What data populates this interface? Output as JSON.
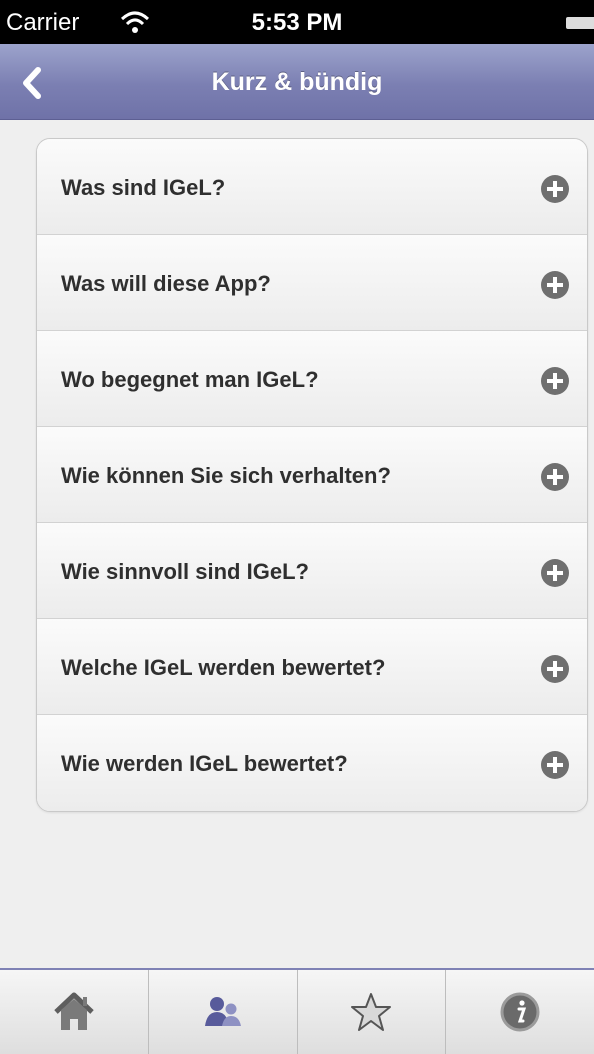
{
  "status_bar": {
    "carrier": "Carrier",
    "time": "5:53 PM"
  },
  "nav": {
    "title": "Kurz & bündig",
    "back_icon": "chevron-left-icon"
  },
  "list": {
    "items": [
      {
        "label": "Was sind IGeL?",
        "icon": "plus-circle-icon"
      },
      {
        "label": "Was will diese App?",
        "icon": "plus-circle-icon"
      },
      {
        "label": "Wo begegnet man IGeL?",
        "icon": "plus-circle-icon"
      },
      {
        "label": "Wie können Sie sich verhalten?",
        "icon": "plus-circle-icon"
      },
      {
        "label": "Wie sinnvoll sind IGeL?",
        "icon": "plus-circle-icon"
      },
      {
        "label": "Welche IGeL werden bewertet?",
        "icon": "plus-circle-icon"
      },
      {
        "label": "Wie werden IGeL bewertet?",
        "icon": "plus-circle-icon"
      }
    ]
  },
  "tab_bar": {
    "tabs": [
      {
        "icon": "home-icon"
      },
      {
        "icon": "people-icon"
      },
      {
        "icon": "star-icon"
      },
      {
        "icon": "info-icon"
      }
    ]
  },
  "colors": {
    "nav_bar": "#7b7fb2",
    "accent": "#585b9b",
    "plus_icon": "#6f6f6f"
  }
}
